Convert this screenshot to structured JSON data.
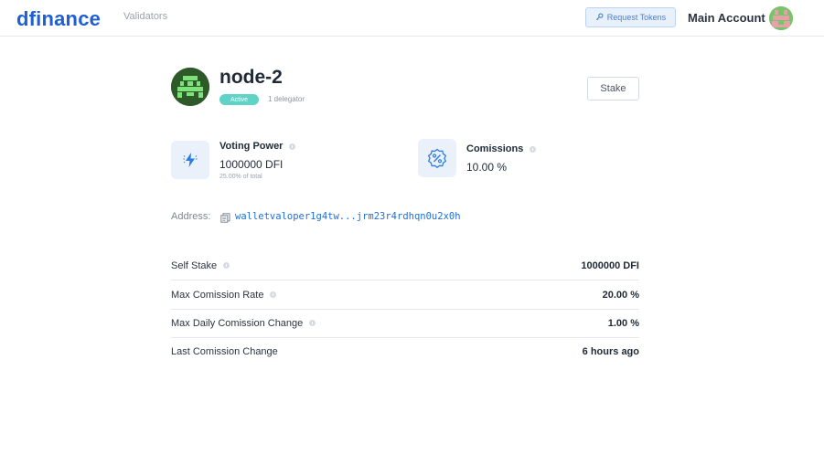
{
  "header": {
    "logo": "dfinance",
    "nav_validators": "Validators",
    "request_tokens": "Request Tokens",
    "account_name": "Main Account"
  },
  "node": {
    "name": "node-2",
    "status": "Active",
    "delegators": "1 delegator",
    "stake_label": "Stake"
  },
  "stats": {
    "voting_power": {
      "title": "Voting Power",
      "value": "1000000 DFI",
      "sub": "25.00% of total"
    },
    "commissions": {
      "title": "Comissions",
      "value": "10.00 %"
    }
  },
  "address": {
    "label": "Address:",
    "value": "walletvaloper1g4tw...jrm23r4rdhqn0u2x0h"
  },
  "details": [
    {
      "label": "Self Stake",
      "value": "1000000 DFI"
    },
    {
      "label": "Max Comission Rate",
      "value": "20.00 %"
    },
    {
      "label": "Max Daily Comission Change",
      "value": "1.00 %"
    },
    {
      "label": "Last Comission Change",
      "value": "6 hours ago"
    }
  ],
  "colors": {
    "brand": "#1e5fd1",
    "active_badge": "#5fd3c6",
    "link": "#1e6fd9"
  }
}
